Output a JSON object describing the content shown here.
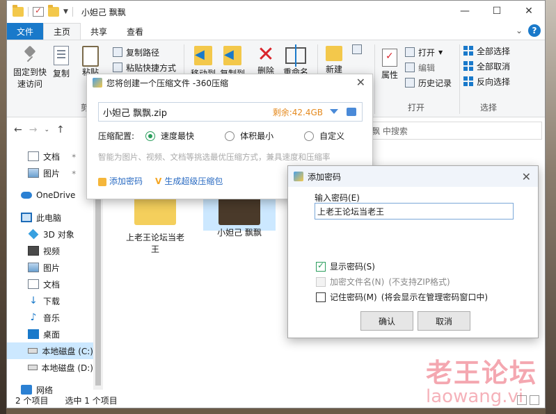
{
  "window": {
    "title": "小妲己 飘飘",
    "controls": [
      "—",
      "☐",
      "✕"
    ]
  },
  "ribbon_tabs": [
    "文件",
    "主页",
    "共享",
    "查看"
  ],
  "ribbon": {
    "pin": [
      "固定到快",
      "速访问"
    ],
    "copy": "复制",
    "paste": "粘贴",
    "copy_path": "复制路径",
    "paste_shortcut": "粘贴快捷方式",
    "cut": "剪",
    "move_to": "移动到",
    "copy_to": "复制到",
    "delete": "删除",
    "rename": "重命名",
    "new_folder": "新建",
    "properties": "属性",
    "open": "打开",
    "edit": "编辑",
    "history": "历史记录",
    "select_all": "全部选择",
    "select_none": "全部取消",
    "invert": "反向选择",
    "group_open": "打开",
    "group_select": "选择"
  },
  "address": {
    "search_placeholder": "在 小妲己 飘飘 中搜索",
    "search_visible": "飘飘 中搜索"
  },
  "nav_pane": [
    {
      "label": "文档",
      "icon": "doc",
      "pinned": true
    },
    {
      "label": "图片",
      "icon": "pic",
      "pinned": true
    },
    {
      "label": "OneDrive",
      "icon": "cloud"
    },
    {
      "label": "此电脑",
      "icon": "pc"
    },
    {
      "label": "3D 对象",
      "icon": "cube"
    },
    {
      "label": "视频",
      "icon": "vid"
    },
    {
      "label": "图片",
      "icon": "pic"
    },
    {
      "label": "文档",
      "icon": "doc"
    },
    {
      "label": "下载",
      "icon": "down"
    },
    {
      "label": "音乐",
      "icon": "music"
    },
    {
      "label": "桌面",
      "icon": "desk"
    },
    {
      "label": "本地磁盘 (C:)",
      "icon": "drive",
      "selected": true
    },
    {
      "label": "本地磁盘 (D:)",
      "icon": "drive"
    },
    {
      "label": "网络",
      "icon": "net"
    }
  ],
  "content": {
    "items": [
      {
        "label_line1": "上老王论坛当老",
        "label_line2": "王"
      },
      {
        "label_line1": "小妲己 飘飘",
        "label_line2": ""
      }
    ]
  },
  "status": {
    "count": "2 个项目",
    "selected": "选中 1 个项目"
  },
  "dialog360": {
    "title": "您将创建一个压缩文件 -360压缩",
    "filename": "小妲己 飘飘.zip",
    "space_left": "剩余:42.4GB",
    "config_label": "压缩配置:",
    "options": [
      "速度最快",
      "体积最小",
      "自定义"
    ],
    "selected_option": "速度最快",
    "hint": "智能为图片、视频、文档等挑选最优压缩方式，兼具速度和压缩率",
    "add_password": "添加密码",
    "super_package": "生成超级压缩包"
  },
  "dialogpw": {
    "title": "添加密码",
    "input_label": "输入密码(E)",
    "password_value": "上老王论坛当老王",
    "show_password": "显示密码(S)",
    "show_password_checked": true,
    "encrypt_names": "加密文件名(N)",
    "encrypt_note": "(不支持ZIP格式)",
    "remember": "记住密码(M)",
    "remember_note": "(将会显示在管理密码窗口中)",
    "ok": "确认",
    "cancel": "取消"
  },
  "watermark": {
    "line1": "老王论坛",
    "line2": "laowang.vi"
  },
  "colors": {
    "accent": "#1979ca",
    "green": "#2a9d5c",
    "orange": "#e58a1f"
  }
}
